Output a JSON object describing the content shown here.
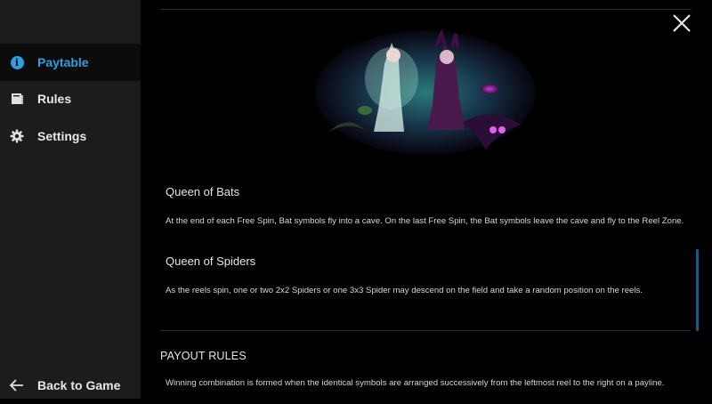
{
  "sidebar": {
    "items": [
      {
        "label": "Paytable",
        "icon": "info-icon",
        "active": true
      },
      {
        "label": "Rules",
        "icon": "book-icon",
        "active": false
      },
      {
        "label": "Settings",
        "icon": "gear-icon",
        "active": false
      }
    ],
    "back_label": "Back to Game"
  },
  "content": {
    "sections": [
      {
        "title": "Queen of Bats",
        "text": "At the end of each Free Spin, Bat symbols fly into a cave. On the last Free Spin, the Bat symbols leave the cave and fly to the Reel Zone."
      },
      {
        "title": "Queen of Spiders",
        "text": "As the reels spin, one or two 2x2 Spiders or one 3x3 Spider may descend on the field and take a random position on the reels."
      }
    ],
    "payout_heading": "PAYOUT RULES",
    "payout_text": "Winning combination is formed when the identical symbols are arranged successively from the leftmost reel to the right on a payline."
  },
  "colors": {
    "accent": "#2e9fe0",
    "sidebar_bg": "#1c1c1c",
    "main_bg": "#000000"
  }
}
